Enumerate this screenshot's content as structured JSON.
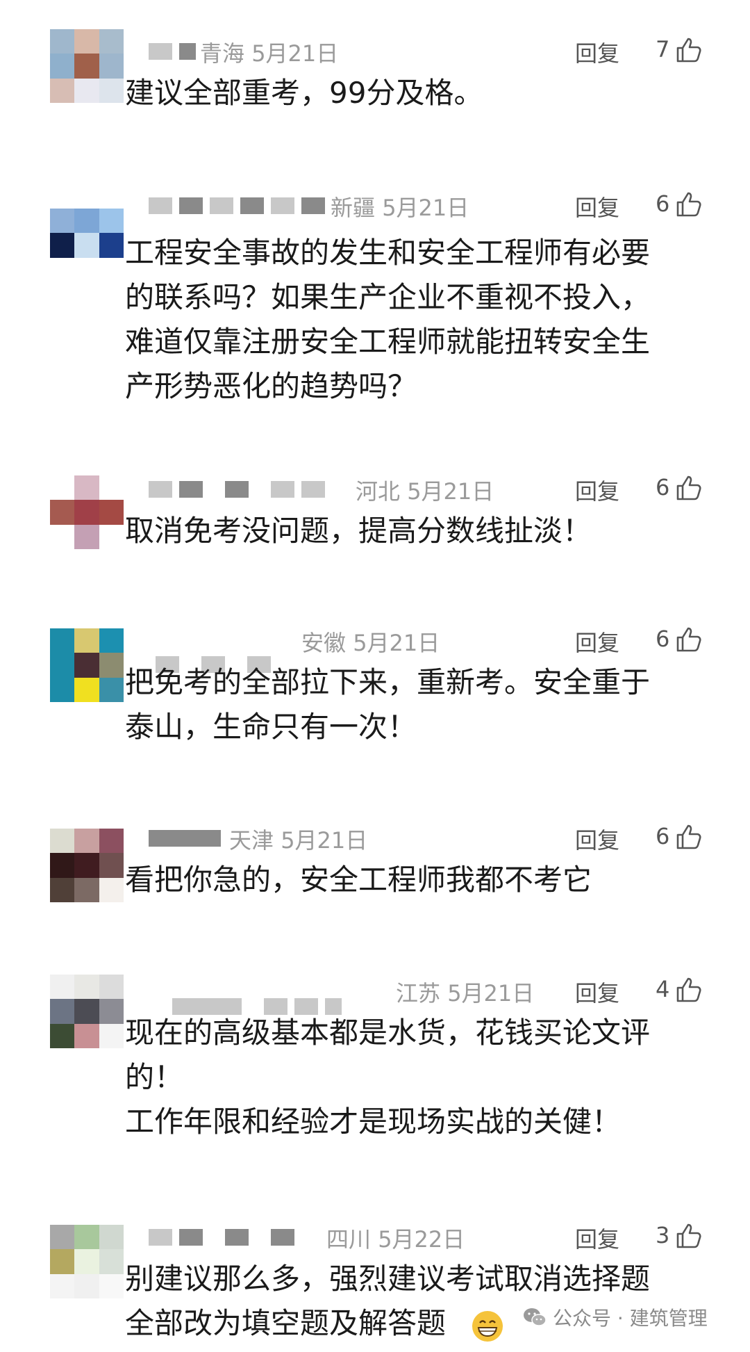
{
  "comments": [
    {
      "region": "青海",
      "date": "5月21日",
      "reply": "回复",
      "likes": "7",
      "text": "建议全部重考，99分及格。",
      "avatar": [
        "#9fb7cc",
        "#d8b8a8",
        "#a8bccc",
        "#8fb0cc",
        "#a0604a",
        "#9eb6cc",
        "#d7bdb4",
        "#e8e8f0",
        "#dde4ec"
      ]
    },
    {
      "region": "新疆",
      "date": "5月21日",
      "reply": "回复",
      "likes": "6",
      "text": "工程安全事故的发生和安全工程师有必要\n的联系吗？如果生产企业不重视不投入，\n难道仅靠注册安全工程师就能扭转安全生\n产形势恶化的趋势吗？",
      "avatar": [
        "#8fb0d8",
        "#7da6d6",
        "#9cc4ea",
        "#0f1f4a",
        "#c9def0",
        "#1c3f8c",
        "#ffffff",
        "#ffffff",
        "#ffffff"
      ]
    },
    {
      "region": "河北",
      "date": "5月21日",
      "reply": "回复",
      "likes": "6",
      "text": "取消免考没问题，提高分数线扯淡！",
      "avatar": [
        "#ffffff",
        "#d8b8c4",
        "#ffffff",
        "#a55a50",
        "#a04048",
        "#a44a44",
        "#ffffff",
        "#c4a0b4",
        "#ffffff"
      ]
    },
    {
      "region": "安徽",
      "date": "5月21日",
      "reply": "回复",
      "likes": "6",
      "text": "把免考的全部拉下来，重新考。安全重于\n泰山，生命只有一次！",
      "avatar": [
        "#1c8ca8",
        "#d8c870",
        "#1c90b0",
        "#1c8ca8",
        "#4a2e34",
        "#8c8c70",
        "#1c8ca8",
        "#f0e020",
        "#3a90a8"
      ]
    },
    {
      "region": "天津",
      "date": "5月21日",
      "reply": "回复",
      "likes": "6",
      "text": "看把你急的，安全工程师我都不考它",
      "avatar": [
        "#dcdcd0",
        "#c8a0a0",
        "#8c5060",
        "#301818",
        "#401c20",
        "#705050",
        "#504038",
        "#7c6a64",
        "#f4f0ec"
      ]
    },
    {
      "region": "江苏",
      "date": "5月21日",
      "reply": "回复",
      "likes": "4",
      "text": "现在的高级基本都是水货，花钱买论文评\n的！\n工作年限和经验才是现场实战的关健！",
      "avatar": [
        "#f0f0f0",
        "#e8e8e4",
        "#dcdcdc",
        "#6c7484",
        "#4c4c54",
        "#8c8c94",
        "#3c4c34",
        "#c89094",
        "#f4f4f4"
      ]
    },
    {
      "region": "四川",
      "date": "5月22日",
      "reply": "回复",
      "likes": "3",
      "text": "别建议那么多，强烈建议考试取消选择题\n全部改为填空题及解答题",
      "avatar": [
        "#a8a8a8",
        "#a8c89c",
        "#d0d8d0",
        "#b4a860",
        "#eaf2e0",
        "#d8e0d8",
        "#f4f4f4",
        "#f0f0f0",
        "#f8f8f8"
      ]
    }
  ],
  "watermark": {
    "icon": "wechat-icon",
    "text": "公众号 · 建筑管理"
  },
  "emoji": "grinning-face-icon",
  "colors": {
    "meta": "#9a9a9a",
    "text": "#1a1a1a",
    "reply": "#555555"
  }
}
